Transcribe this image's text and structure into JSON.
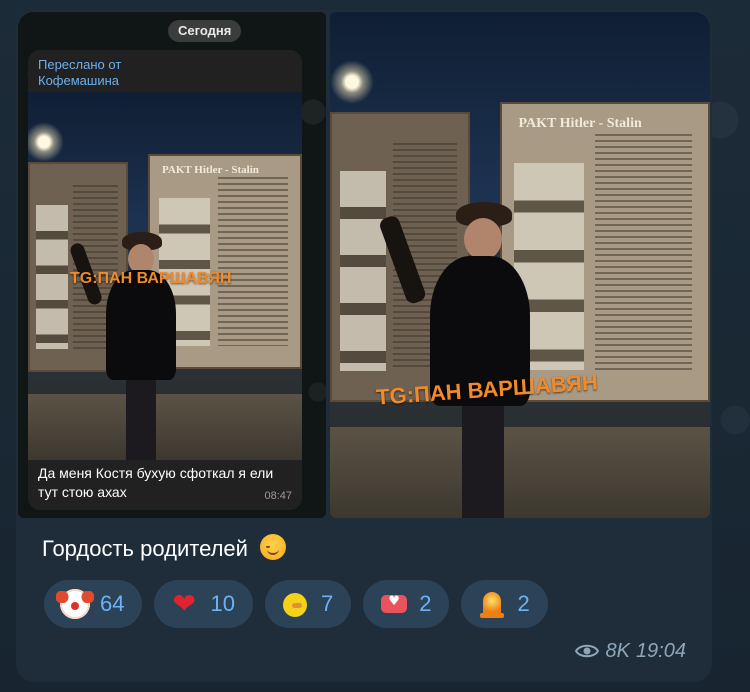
{
  "forwarded": {
    "date_label": "Сегодня",
    "header_prefix": "Переслано от",
    "header_source": "Кофемашина",
    "caption": "Да меня Костя бухую сфоткал я ели тут стою ахах",
    "time": "08:47",
    "photo_heading": "PAKT Hitler - Stalin",
    "watermark": "TG:ПАН ВАРШАВЯН"
  },
  "photo": {
    "heading": "PAKT Hitler - Stalin",
    "watermark": "TG:ПАН ВАРШАВЯН"
  },
  "message": {
    "caption": "Гордость родителей",
    "caption_emoji": "smiling-face-icon",
    "views": "8K",
    "time": "19:04"
  },
  "reactions": [
    {
      "icon": "clown-icon",
      "count": "64"
    },
    {
      "icon": "red-heart-icon",
      "count": "10"
    },
    {
      "icon": "duck-icon",
      "count": "7"
    },
    {
      "icon": "heart-message-icon",
      "count": "2"
    },
    {
      "icon": "siren-icon",
      "count": "2"
    }
  ],
  "colors": {
    "accent": "#6cb3f3",
    "bubble": "#1f2d3a",
    "reaction_bg": "#2c4257",
    "watermark": "#f08a2a"
  }
}
